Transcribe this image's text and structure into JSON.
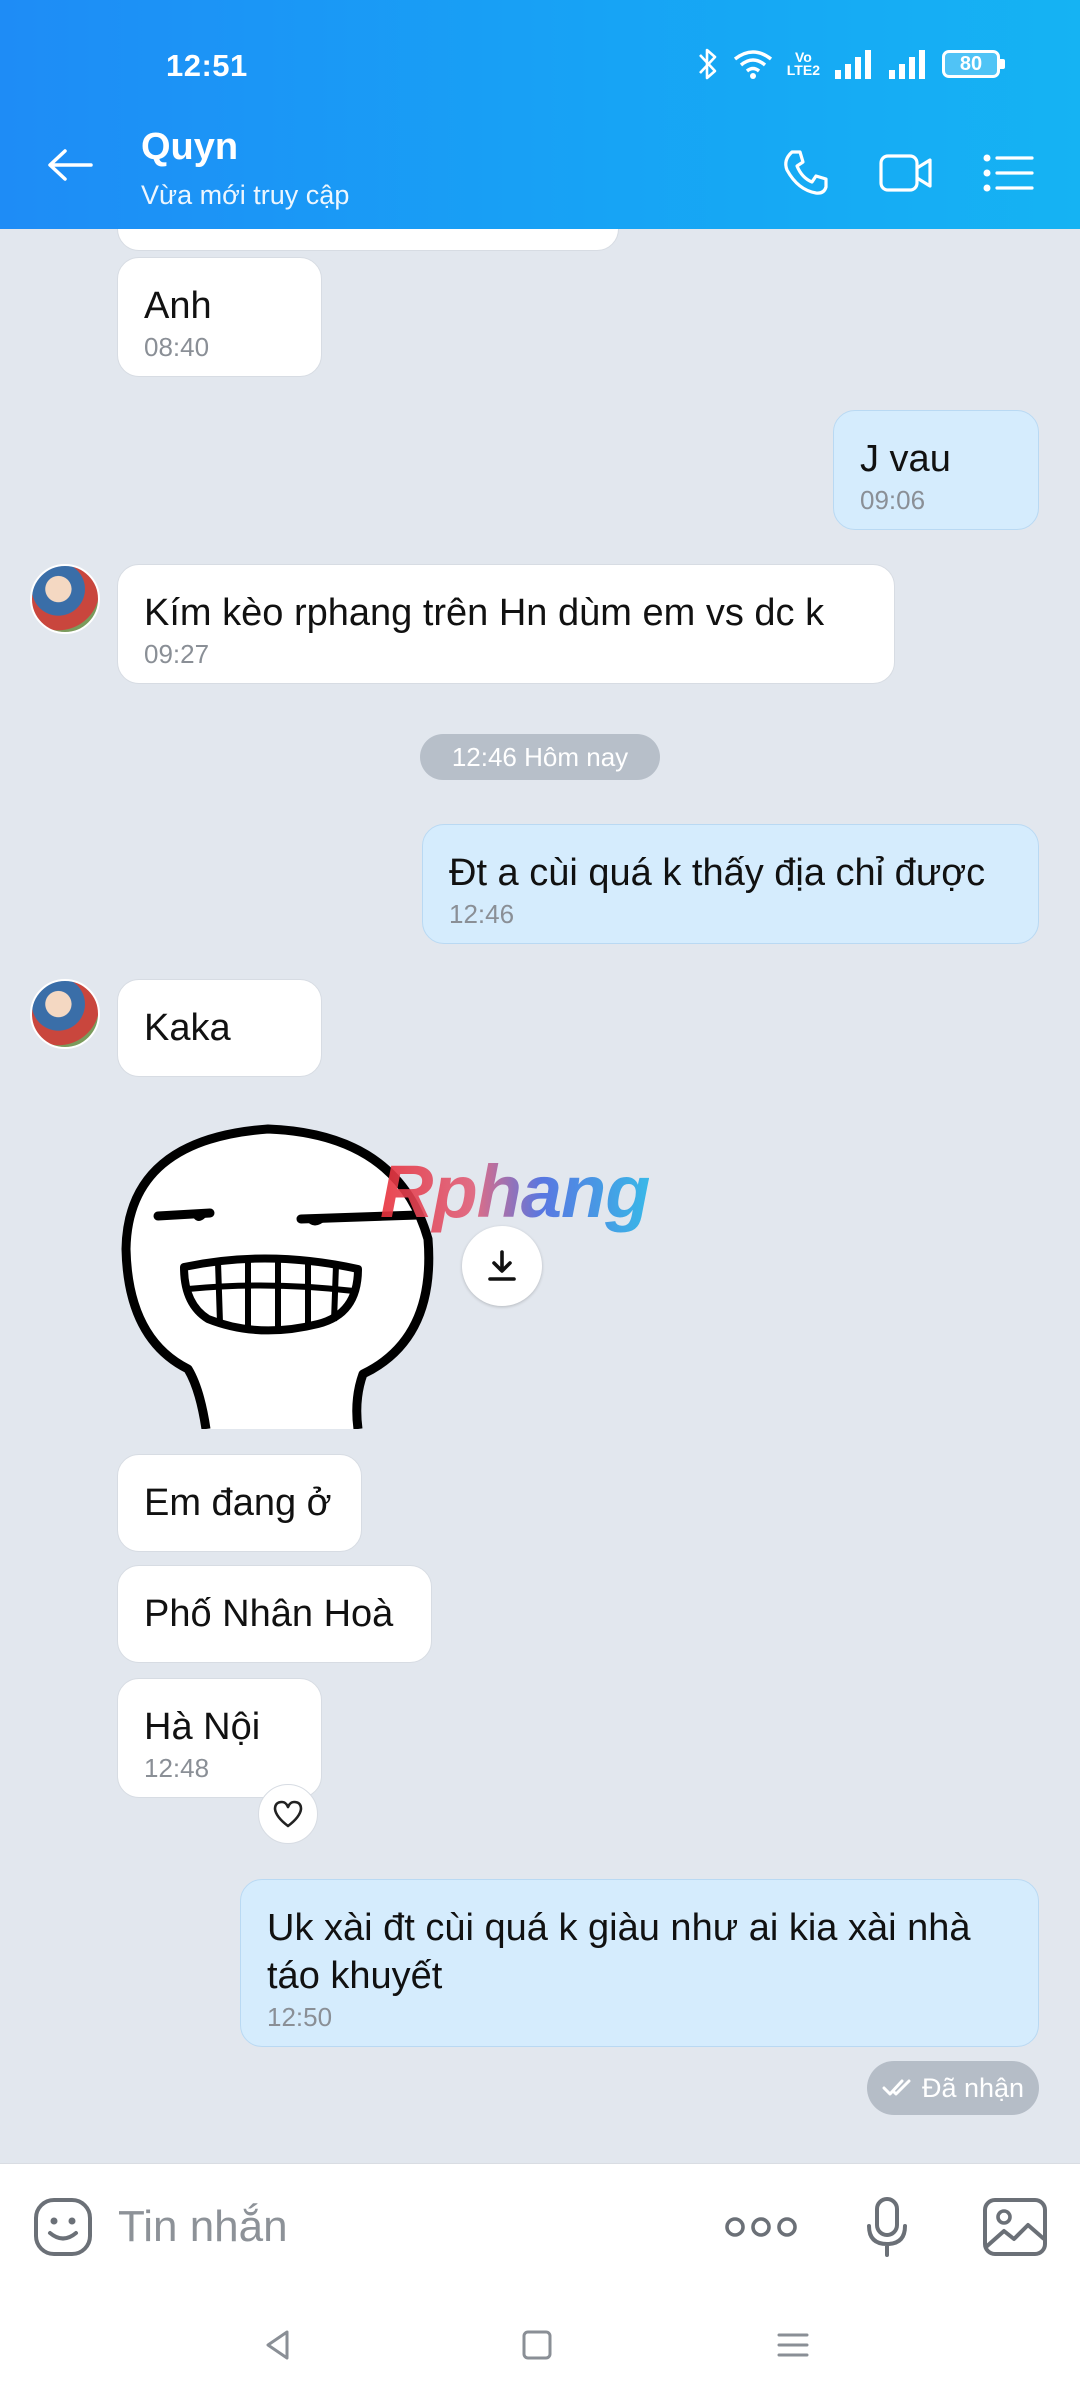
{
  "status_bar": {
    "time": "12:51",
    "battery": "80",
    "volte": "Vo LTE2"
  },
  "header": {
    "name": "Quyn",
    "status": "Vừa mới truy cập"
  },
  "messages": [
    {
      "text": "Anh",
      "time": "08:40"
    },
    {
      "text": "J vau",
      "time": "09:06"
    },
    {
      "text": "Kím kèo rphang trên Hn dùm em vs dc k",
      "time": "09:27"
    },
    {
      "text": "Đt a cùi quá k thấy địa chỉ được",
      "time": "12:46"
    },
    {
      "text": "Kaka"
    },
    {
      "text": "Em đang ở"
    },
    {
      "text": "Phố Nhân Hoà"
    },
    {
      "text": "Hà Nội",
      "time": "12:48"
    },
    {
      "text": "Uk xài đt cùi quá k giàu như ai kia xài nhà táo khuyết",
      "time": "12:50"
    }
  ],
  "date_divider": "12:46 Hôm nay",
  "delivered_status": "Đã nhận",
  "watermark": "Rphang",
  "input": {
    "placeholder": "Tin nhắn"
  },
  "colors": {
    "header_start": "#1e8cf6",
    "header_end": "#15b3f3",
    "outgoing_bubble": "#d5ecfd",
    "incoming_bubble": "#ffffff",
    "chat_bg": "#e2e7ee"
  }
}
